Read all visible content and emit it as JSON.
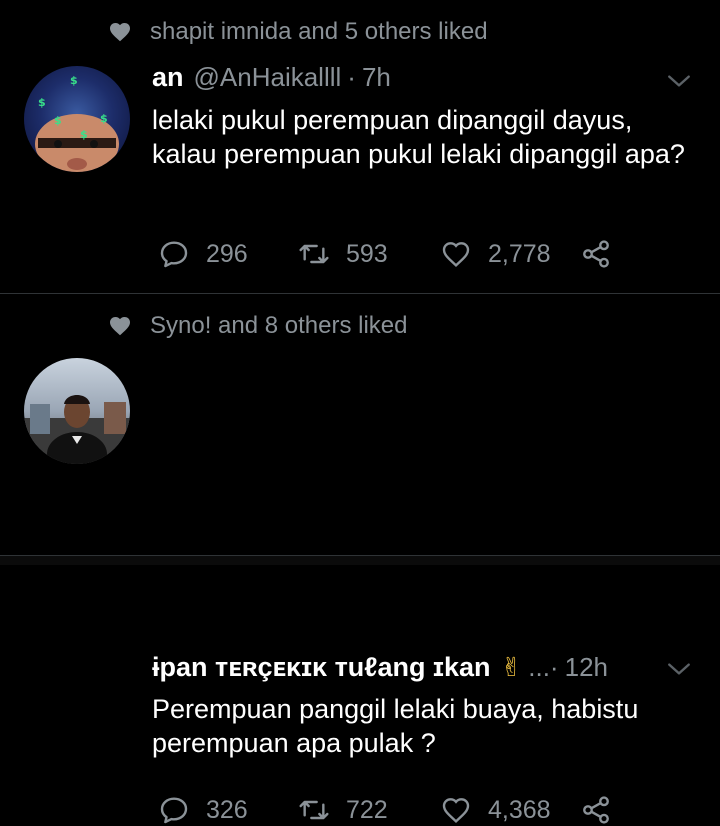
{
  "tweets": [
    {
      "social_context": "shapit imnida and 5 others liked",
      "display_name": "an",
      "handle": "@AnHaikallll",
      "dot": "·",
      "time": "7h",
      "emoji": "",
      "text": "lelaki pukul perempuan dipanggil dayus, kalau perempuan pukul lelaki dipanggil apa?",
      "replies": "296",
      "retweets": "593",
      "likes": "2,778"
    },
    {
      "social_context": "Syno! and 8 others liked",
      "display_name": "ɨpan ᴛᴇʀçᴇᴋɪᴋ ᴛuℓang ɪkan",
      "handle": "",
      "dot": "...·",
      "time": "12h",
      "emoji": "✌",
      "text": "Perempuan panggil lelaki buaya, habistu perempuan apa pulak ?",
      "replies": "326",
      "retweets": "722",
      "likes": "4,368"
    }
  ],
  "icons": {
    "social": "heart-filled-icon",
    "reply": "reply-icon",
    "retweet": "retweet-icon",
    "like": "heart-outline-icon",
    "share": "share-icon",
    "menu": "chevron-down-icon"
  },
  "colors": {
    "background": "#000000",
    "text": "#ffffff",
    "secondary": "#8b9298",
    "divider": "#2f3336"
  }
}
